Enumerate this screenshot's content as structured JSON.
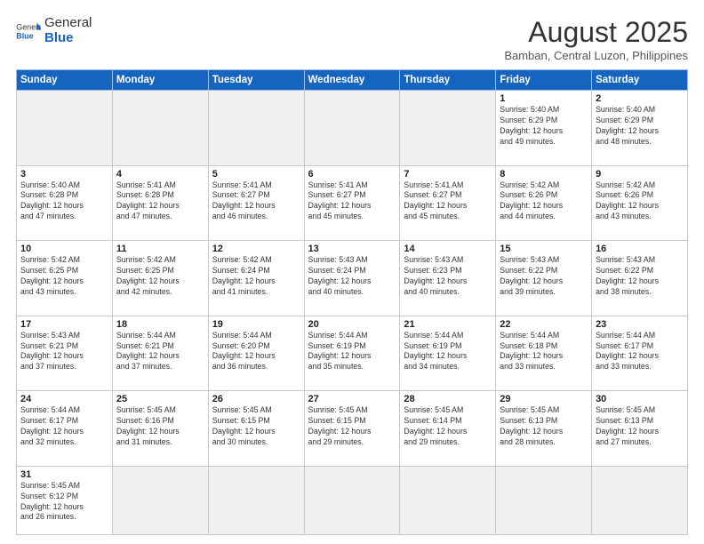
{
  "header": {
    "logo_general": "General",
    "logo_blue": "Blue",
    "month_year": "August 2025",
    "location": "Bamban, Central Luzon, Philippines"
  },
  "days_of_week": [
    "Sunday",
    "Monday",
    "Tuesday",
    "Wednesday",
    "Thursday",
    "Friday",
    "Saturday"
  ],
  "weeks": [
    [
      {
        "day": "",
        "info": ""
      },
      {
        "day": "",
        "info": ""
      },
      {
        "day": "",
        "info": ""
      },
      {
        "day": "",
        "info": ""
      },
      {
        "day": "",
        "info": ""
      },
      {
        "day": "1",
        "info": "Sunrise: 5:40 AM\nSunset: 6:29 PM\nDaylight: 12 hours\nand 49 minutes."
      },
      {
        "day": "2",
        "info": "Sunrise: 5:40 AM\nSunset: 6:29 PM\nDaylight: 12 hours\nand 48 minutes."
      }
    ],
    [
      {
        "day": "3",
        "info": "Sunrise: 5:40 AM\nSunset: 6:28 PM\nDaylight: 12 hours\nand 47 minutes."
      },
      {
        "day": "4",
        "info": "Sunrise: 5:41 AM\nSunset: 6:28 PM\nDaylight: 12 hours\nand 47 minutes."
      },
      {
        "day": "5",
        "info": "Sunrise: 5:41 AM\nSunset: 6:27 PM\nDaylight: 12 hours\nand 46 minutes."
      },
      {
        "day": "6",
        "info": "Sunrise: 5:41 AM\nSunset: 6:27 PM\nDaylight: 12 hours\nand 45 minutes."
      },
      {
        "day": "7",
        "info": "Sunrise: 5:41 AM\nSunset: 6:27 PM\nDaylight: 12 hours\nand 45 minutes."
      },
      {
        "day": "8",
        "info": "Sunrise: 5:42 AM\nSunset: 6:26 PM\nDaylight: 12 hours\nand 44 minutes."
      },
      {
        "day": "9",
        "info": "Sunrise: 5:42 AM\nSunset: 6:26 PM\nDaylight: 12 hours\nand 43 minutes."
      }
    ],
    [
      {
        "day": "10",
        "info": "Sunrise: 5:42 AM\nSunset: 6:25 PM\nDaylight: 12 hours\nand 43 minutes."
      },
      {
        "day": "11",
        "info": "Sunrise: 5:42 AM\nSunset: 6:25 PM\nDaylight: 12 hours\nand 42 minutes."
      },
      {
        "day": "12",
        "info": "Sunrise: 5:42 AM\nSunset: 6:24 PM\nDaylight: 12 hours\nand 41 minutes."
      },
      {
        "day": "13",
        "info": "Sunrise: 5:43 AM\nSunset: 6:24 PM\nDaylight: 12 hours\nand 40 minutes."
      },
      {
        "day": "14",
        "info": "Sunrise: 5:43 AM\nSunset: 6:23 PM\nDaylight: 12 hours\nand 40 minutes."
      },
      {
        "day": "15",
        "info": "Sunrise: 5:43 AM\nSunset: 6:22 PM\nDaylight: 12 hours\nand 39 minutes."
      },
      {
        "day": "16",
        "info": "Sunrise: 5:43 AM\nSunset: 6:22 PM\nDaylight: 12 hours\nand 38 minutes."
      }
    ],
    [
      {
        "day": "17",
        "info": "Sunrise: 5:43 AM\nSunset: 6:21 PM\nDaylight: 12 hours\nand 37 minutes."
      },
      {
        "day": "18",
        "info": "Sunrise: 5:44 AM\nSunset: 6:21 PM\nDaylight: 12 hours\nand 37 minutes."
      },
      {
        "day": "19",
        "info": "Sunrise: 5:44 AM\nSunset: 6:20 PM\nDaylight: 12 hours\nand 36 minutes."
      },
      {
        "day": "20",
        "info": "Sunrise: 5:44 AM\nSunset: 6:19 PM\nDaylight: 12 hours\nand 35 minutes."
      },
      {
        "day": "21",
        "info": "Sunrise: 5:44 AM\nSunset: 6:19 PM\nDaylight: 12 hours\nand 34 minutes."
      },
      {
        "day": "22",
        "info": "Sunrise: 5:44 AM\nSunset: 6:18 PM\nDaylight: 12 hours\nand 33 minutes."
      },
      {
        "day": "23",
        "info": "Sunrise: 5:44 AM\nSunset: 6:17 PM\nDaylight: 12 hours\nand 33 minutes."
      }
    ],
    [
      {
        "day": "24",
        "info": "Sunrise: 5:44 AM\nSunset: 6:17 PM\nDaylight: 12 hours\nand 32 minutes."
      },
      {
        "day": "25",
        "info": "Sunrise: 5:45 AM\nSunset: 6:16 PM\nDaylight: 12 hours\nand 31 minutes."
      },
      {
        "day": "26",
        "info": "Sunrise: 5:45 AM\nSunset: 6:15 PM\nDaylight: 12 hours\nand 30 minutes."
      },
      {
        "day": "27",
        "info": "Sunrise: 5:45 AM\nSunset: 6:15 PM\nDaylight: 12 hours\nand 29 minutes."
      },
      {
        "day": "28",
        "info": "Sunrise: 5:45 AM\nSunset: 6:14 PM\nDaylight: 12 hours\nand 29 minutes."
      },
      {
        "day": "29",
        "info": "Sunrise: 5:45 AM\nSunset: 6:13 PM\nDaylight: 12 hours\nand 28 minutes."
      },
      {
        "day": "30",
        "info": "Sunrise: 5:45 AM\nSunset: 6:13 PM\nDaylight: 12 hours\nand 27 minutes."
      }
    ],
    [
      {
        "day": "31",
        "info": "Sunrise: 5:45 AM\nSunset: 6:12 PM\nDaylight: 12 hours\nand 26 minutes."
      },
      {
        "day": "",
        "info": ""
      },
      {
        "day": "",
        "info": ""
      },
      {
        "day": "",
        "info": ""
      },
      {
        "day": "",
        "info": ""
      },
      {
        "day": "",
        "info": ""
      },
      {
        "day": "",
        "info": ""
      }
    ]
  ]
}
